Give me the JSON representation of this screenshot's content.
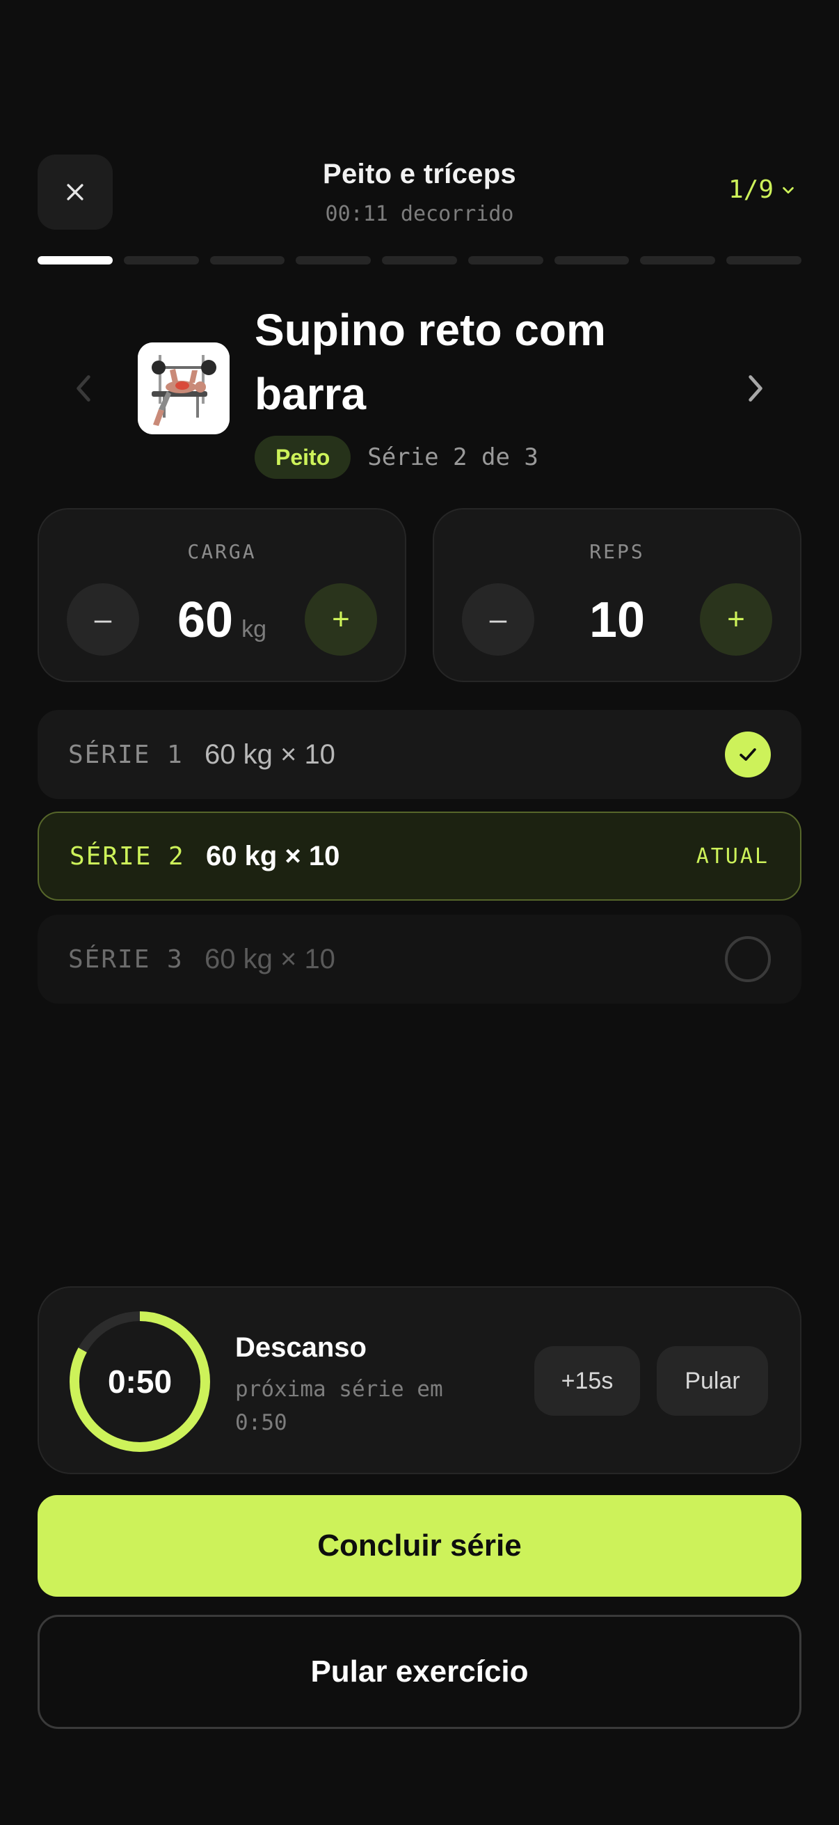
{
  "header": {
    "close_icon": "close-icon",
    "title": "Peito e tríceps",
    "elapsed": "00:11 decorrido",
    "counter": "1/9",
    "counter_icon": "chevron-down-icon"
  },
  "progress": {
    "total_segments": 9,
    "current": 1
  },
  "exercise": {
    "name": "Supino reto com barra",
    "muscle_tag": "Peito",
    "set_progress": "Série 2 de 3",
    "prev_icon": "chevron-left-icon",
    "next_icon": "chevron-right-icon",
    "image": "bench-press-illustration"
  },
  "load": {
    "label": "CARGA",
    "value": "60",
    "unit": "kg",
    "minus": "–",
    "plus": "+"
  },
  "reps": {
    "label": "REPS",
    "value": "10",
    "minus": "–",
    "plus": "+"
  },
  "sets": [
    {
      "name": "SÉRIE 1",
      "detail": "60 kg × 10",
      "status": "done"
    },
    {
      "name": "SÉRIE 2",
      "detail": "60 kg × 10",
      "status": "current",
      "badge": "ATUAL"
    },
    {
      "name": "SÉRIE 3",
      "detail": "60 kg × 10",
      "status": "pending"
    }
  ],
  "rest": {
    "time": "0:50",
    "title": "Descanso",
    "subtitle": "próxima série em 0:50",
    "remaining_fraction": 0.83,
    "add_label": "+15s",
    "skip_label": "Pular"
  },
  "actions": {
    "complete_set": "Concluir série",
    "skip_exercise": "Pular exercício"
  },
  "colors": {
    "background": "#0e0e0e",
    "accent": "#cdf25a",
    "card": "#181818"
  }
}
